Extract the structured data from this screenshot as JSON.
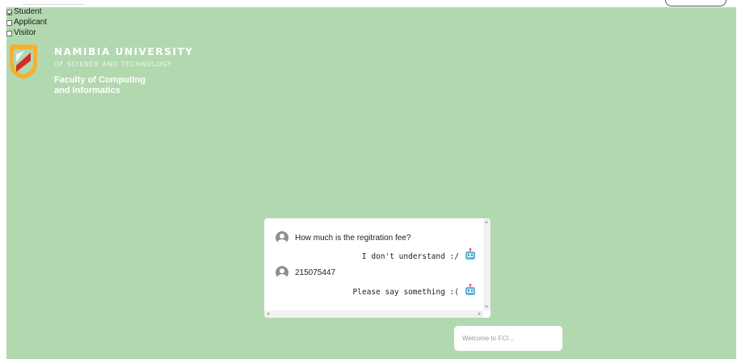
{
  "roles": [
    {
      "label": "Student",
      "checked": true
    },
    {
      "label": "Applicant",
      "checked": false
    },
    {
      "label": "Visitor",
      "checked": false
    }
  ],
  "brand": {
    "name": "NAMIBIA UNIVERSITY",
    "subtitle": "OF SCIENCE AND TECHNOLOGY",
    "faculty_line1": "Faculty of Computing",
    "faculty_line2": "and Informatics",
    "logo_icon": "nust-shield-logo"
  },
  "chat": {
    "messages": [
      {
        "sender": "user",
        "text": "How much is the regitration fee?",
        "icon": "user-avatar-icon"
      },
      {
        "sender": "bot",
        "text": "I don't understand :/",
        "icon": "robot-icon"
      },
      {
        "sender": "user",
        "text": "215075447",
        "icon": "user-avatar-icon"
      },
      {
        "sender": "bot",
        "text": "Please say something :(",
        "icon": "robot-icon"
      }
    ]
  },
  "input": {
    "placeholder": "Welcome to FCI...",
    "value": ""
  },
  "colors": {
    "background": "#b2d8b0",
    "brand_red": "#d52b2b",
    "brand_gold": "#f2b134",
    "robot": "#5ab8e0"
  }
}
